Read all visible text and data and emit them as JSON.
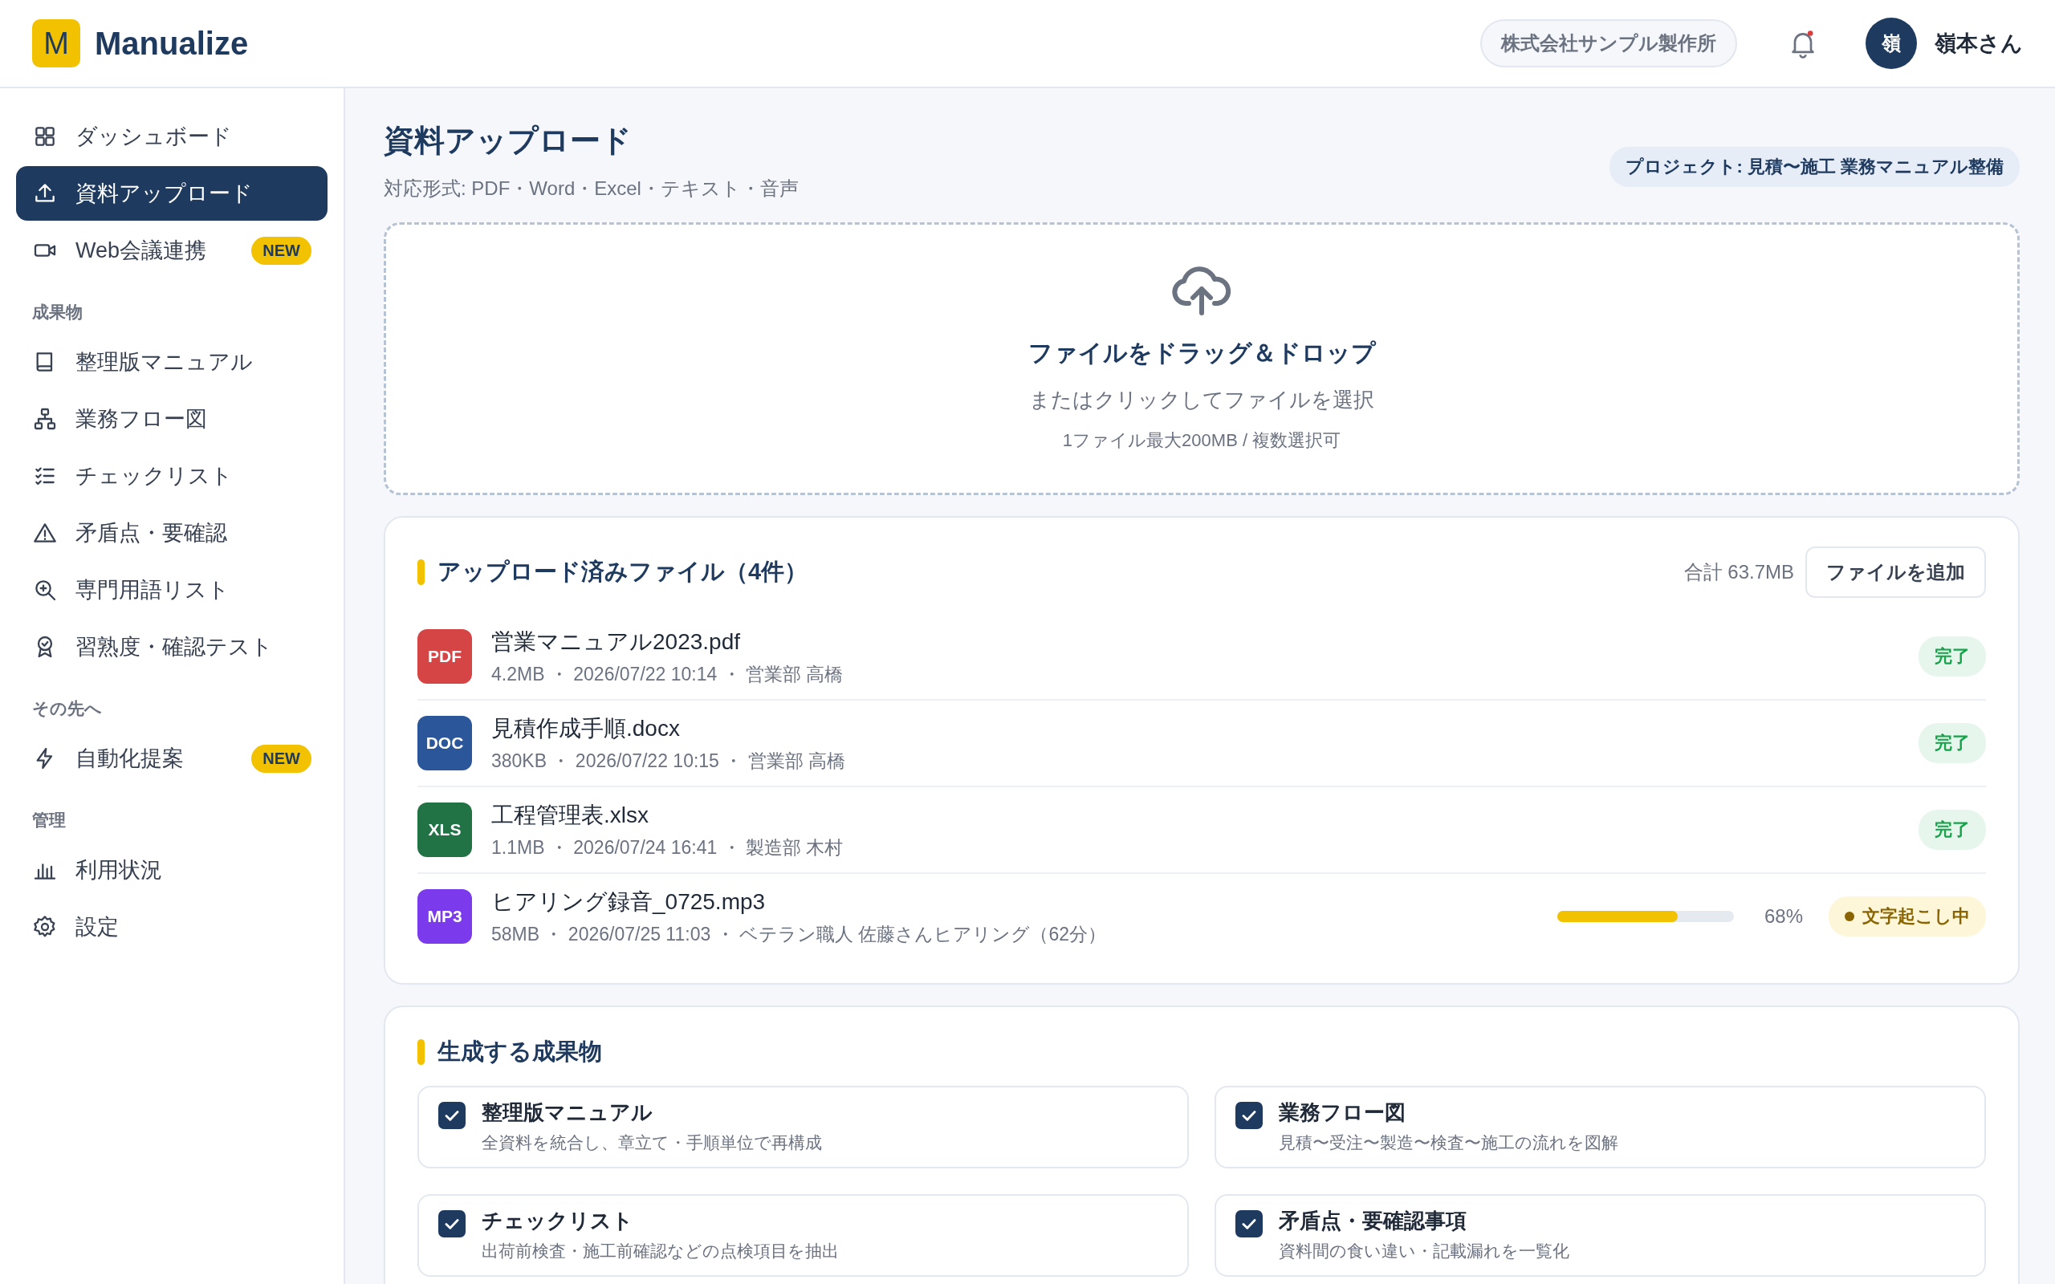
{
  "header": {
    "logo_letter": "M",
    "app_name": "Manualize",
    "company": "株式会社サンプル製作所",
    "notifications_unread": true,
    "avatar_initial": "嶺",
    "user_name": "嶺本さん"
  },
  "sidebar": {
    "sections": [
      {
        "items": [
          {
            "label": "ダッシュボード",
            "selected": false
          },
          {
            "label": "資料アップロード",
            "selected": true
          },
          {
            "label": "Web会議連携",
            "selected": false,
            "badge": "NEW"
          }
        ]
      },
      {
        "heading": "成果物",
        "items": [
          {
            "label": "整理版マニュアル",
            "selected": false
          },
          {
            "label": "業務フロー図",
            "selected": false
          },
          {
            "label": "チェックリスト",
            "selected": false
          },
          {
            "label": "矛盾点・要確認",
            "selected": false
          },
          {
            "label": "専門用語リスト",
            "selected": false
          },
          {
            "label": "習熟度・確認テスト",
            "selected": false
          }
        ]
      },
      {
        "heading": "その先へ",
        "items": [
          {
            "label": "自動化提案",
            "selected": false,
            "badge": "NEW"
          }
        ]
      },
      {
        "heading": "管理",
        "items": [
          {
            "label": "利用状況",
            "selected": false
          },
          {
            "label": "設定",
            "selected": false
          }
        ]
      }
    ]
  },
  "page": {
    "title": "資料アップロード",
    "subtitle": "対応形式: PDF・Word・Excel・テキスト・音声",
    "project": "プロジェクト: 見積〜施工 業務マニュアル整備"
  },
  "dropzone": {
    "title": "ファイルをドラッグ＆ドロップ",
    "hint": "またはクリックしてファイルを選択",
    "limit": "1ファイル最大200MB / 複数選択可"
  },
  "files": {
    "title": "アップロード済みファイル（4件）",
    "total": "合計 63.7MB",
    "add_button": "ファイルを追加",
    "rows": [
      {
        "type": "PDF",
        "color": "#d64545",
        "name": "営業マニュアル2023.pdf",
        "meta": "4.2MB ・ 2026/07/22 10:14 ・ 営業部 高橋",
        "status": {
          "kind": "done",
          "label": "完了"
        }
      },
      {
        "type": "DOC",
        "color": "#2b579a",
        "name": "見積作成手順.docx",
        "meta": "380KB ・ 2026/07/22 10:15 ・ 営業部 高橋",
        "status": {
          "kind": "done",
          "label": "完了"
        }
      },
      {
        "type": "XLS",
        "color": "#217346",
        "name": "工程管理表.xlsx",
        "meta": "1.1MB ・ 2026/07/24 16:41 ・ 製造部 木村",
        "status": {
          "kind": "done",
          "label": "完了"
        }
      },
      {
        "type": "MP3",
        "color": "#7c3aed",
        "name": "ヒアリング録音_0725.mp3",
        "meta": "58MB ・ 2026/07/25 11:03 ・ ベテラン職人 佐藤さんヒアリング（62分）",
        "status": {
          "kind": "processing",
          "label": "文字起こし中",
          "level": 0.68,
          "percent": "68%"
        }
      }
    ]
  },
  "outputs": {
    "title": "生成する成果物",
    "options": [
      {
        "title": "整理版マニュアル",
        "description": "全資料を統合し、章立て・手順単位で再構成",
        "checked": true
      },
      {
        "title": "業務フロー図",
        "description": "見積〜受注〜製造〜検査〜施工の流れを図解",
        "checked": true
      },
      {
        "title": "チェックリスト",
        "description": "出荷前検査・施工前確認などの点検項目を抽出",
        "checked": true
      },
      {
        "title": "矛盾点・要確認事項",
        "description": "資料間の食い違い・記載漏れを一覧化",
        "checked": true
      }
    ]
  }
}
